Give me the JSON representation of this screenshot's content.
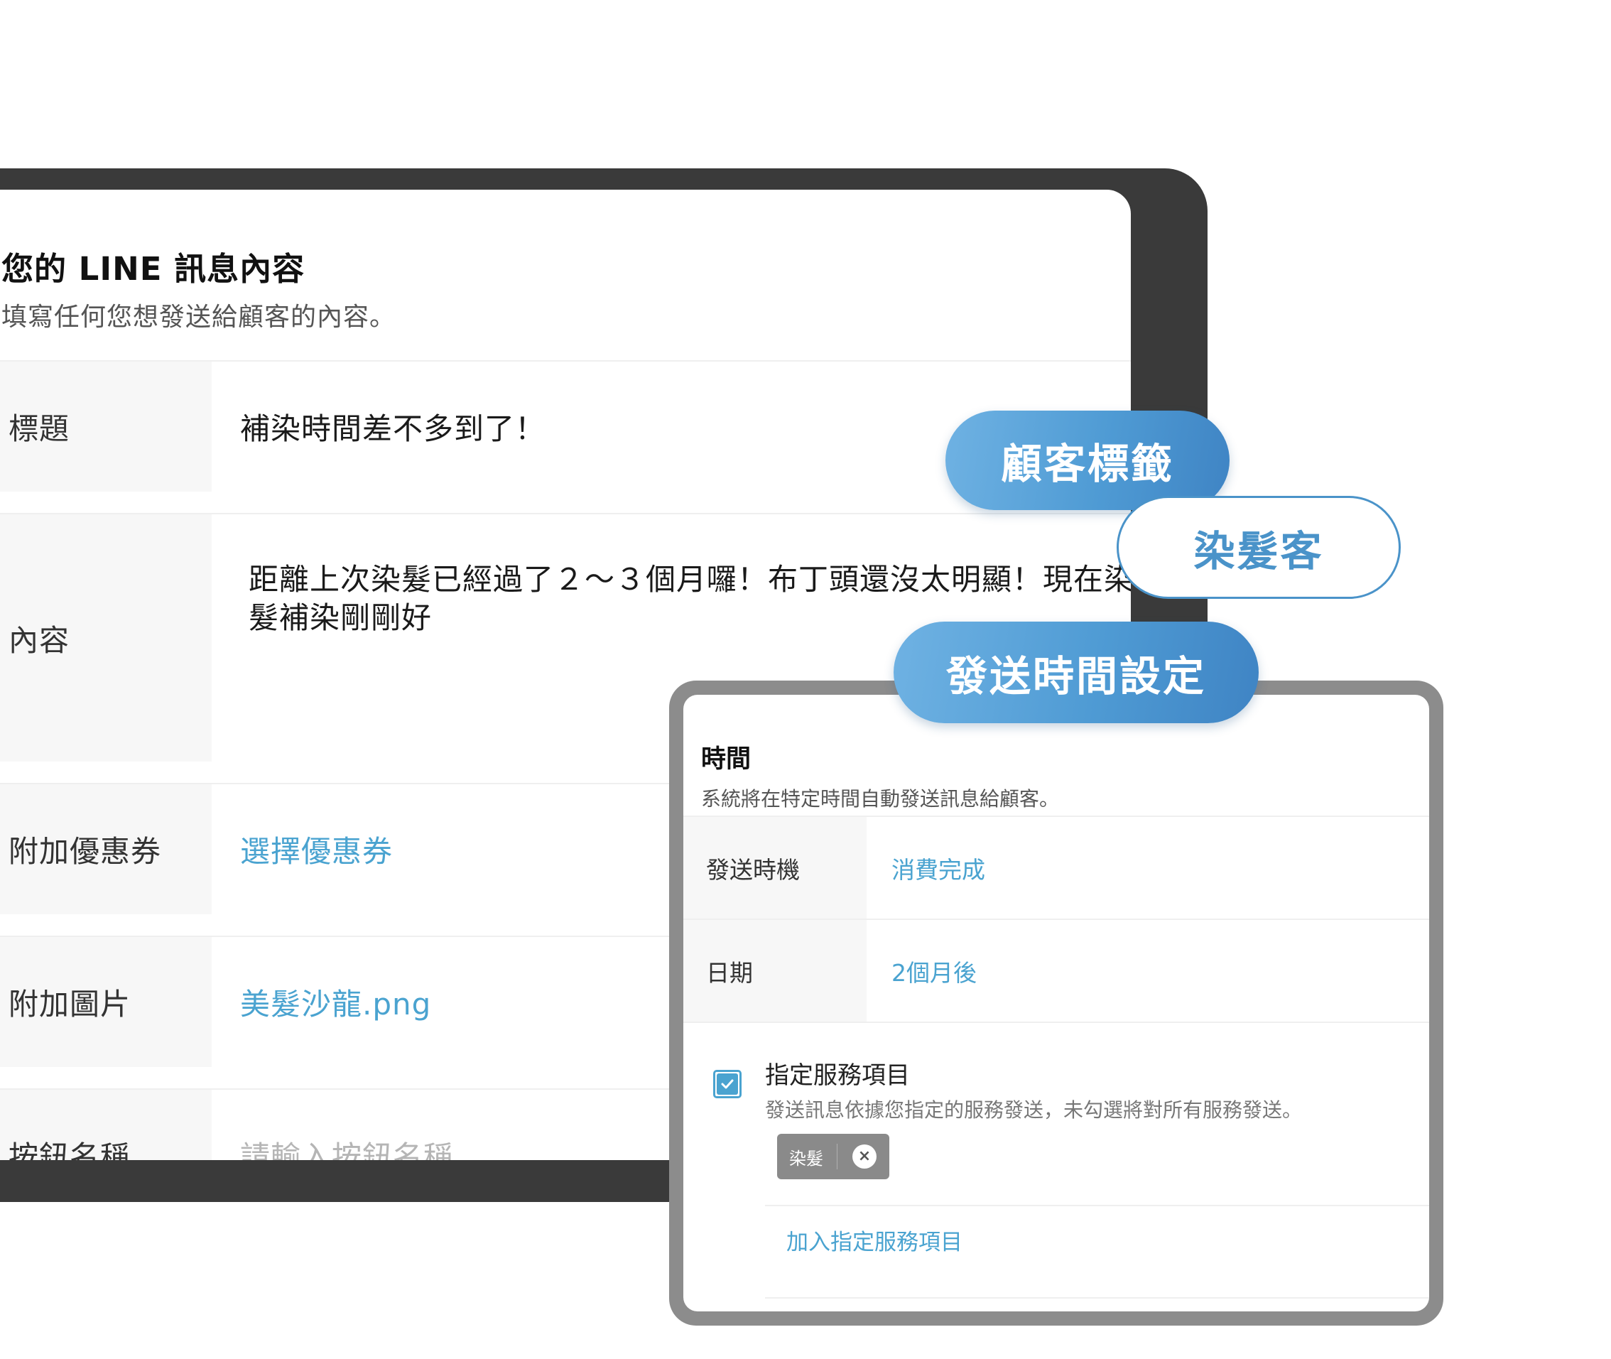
{
  "line_message": {
    "title": "您的 LINE 訊息內容",
    "subtitle": "填寫任何您想發送給顧客的內容。",
    "rows": {
      "title": {
        "label": "標題",
        "value": "補染時間差不多到了！"
      },
      "content": {
        "label": "內容",
        "value": "距離上次染髮已經過了２～３個月囉！布丁頭還沒太明顯！現在染髮補染剛剛好"
      },
      "coupon": {
        "label": "附加優惠券",
        "value": "選擇優惠券"
      },
      "image": {
        "label": "附加圖片",
        "value": "美髮沙龍.png"
      },
      "button": {
        "label": "按鈕名稱",
        "placeholder": "請輸入按鈕名稱"
      }
    }
  },
  "pills": {
    "customer_tag": "顧客標籤",
    "dye_customer": "染髮客",
    "send_time_setting": "發送時間設定"
  },
  "time_settings": {
    "title": "時間",
    "subtitle": "系統將在特定時間自動發送訊息給顧客。",
    "rows": {
      "timing": {
        "label": "發送時機",
        "value": "消費完成"
      },
      "date": {
        "label": "日期",
        "value": "2個月後"
      }
    },
    "service": {
      "checked": true,
      "title": "指定服務項目",
      "subtitle": "發送訊息依據您指定的服務發送，未勾選將對所有服務發送。",
      "chip_label": "染髮",
      "add_label": "加入指定服務項目"
    }
  },
  "colors": {
    "accent": "#4aa3d0",
    "pill_gradient_start": "#6fb2e3",
    "pill_gradient_end": "#3f84c4",
    "tablet_frame": "#3a3a3a",
    "tablet2_frame": "#8c8c8c"
  }
}
